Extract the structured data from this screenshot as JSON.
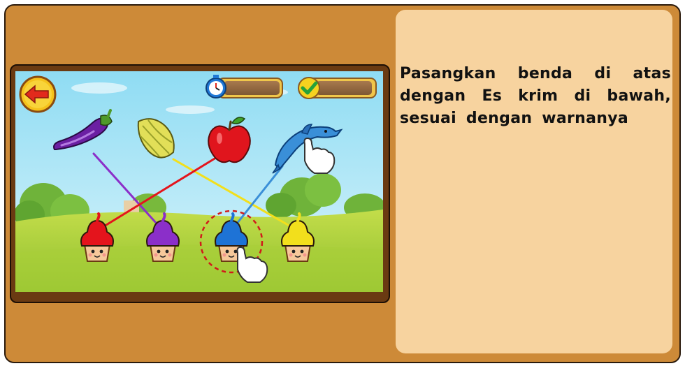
{
  "instruction": {
    "text": "Pasangkan benda di atas dengan Es krim di bawah, sesuai dengan warnanya"
  },
  "game": {
    "objects": [
      {
        "name": "eggplant",
        "color": "#7b2db0"
      },
      {
        "name": "starfruit",
        "color": "#d8d94a"
      },
      {
        "name": "apple",
        "color": "#e0151d"
      },
      {
        "name": "dolphin",
        "color": "#3a8fd8"
      }
    ],
    "cupcakes": [
      {
        "color": "red",
        "hex": "#e4141c"
      },
      {
        "color": "purple",
        "hex": "#8b2fc9"
      },
      {
        "color": "blue",
        "hex": "#1e73d6"
      },
      {
        "color": "yellow",
        "hex": "#f2df1c"
      }
    ],
    "connections": [
      {
        "from": "eggplant",
        "to": "purple",
        "color": "#8b2fc9"
      },
      {
        "from": "starfruit",
        "to": "yellow",
        "color": "#f2df1c"
      },
      {
        "from": "apple",
        "to": "red",
        "color": "#e4141c"
      },
      {
        "from": "dolphin",
        "to": "blue",
        "color": "#3a8fd8"
      }
    ],
    "highlighted_cupcake": "blue",
    "hud": {
      "timer_icon": "stopwatch-icon",
      "score_icon": "checkmark-icon"
    }
  },
  "colors": {
    "board": "#cd8a38",
    "panel": "#f7d39f",
    "frame": "#6a3a12",
    "sky": "#aee8f7",
    "grass": "#a6cf3b"
  }
}
